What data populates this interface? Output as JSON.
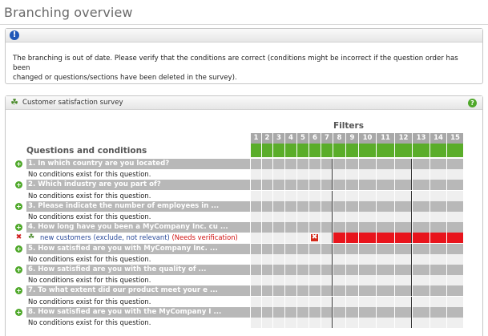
{
  "page": {
    "title": "Branching overview"
  },
  "info": {
    "icon": "exclamation-icon",
    "message_line1": "The branching is out of date. Please verify that the conditions are correct (conditions might be incorrect if the question order has been",
    "message_line2": "changed or questions/sections have been deleted in the survey)."
  },
  "survey": {
    "title": "Customer satisfaction survey",
    "help_icon": "?",
    "filters_label": "Filters",
    "questions_label": "Questions and conditions",
    "filter_numbers": [
      "1",
      "2",
      "3",
      "4",
      "5",
      "6",
      "7",
      "8",
      "9",
      "10",
      "11",
      "12",
      "13",
      "14",
      "15"
    ],
    "rows": [
      {
        "kind": "question",
        "text": "1. In which country are you located?"
      },
      {
        "kind": "condition",
        "text": "No conditions exist for this question."
      },
      {
        "kind": "question",
        "text": "2. Which industry are you part of?"
      },
      {
        "kind": "condition",
        "text": "No conditions exist for this question."
      },
      {
        "kind": "question",
        "text": "3. Please indicate the number of employees in ..."
      },
      {
        "kind": "condition",
        "text": "No conditions exist for this question."
      },
      {
        "kind": "question",
        "text": "4. How long have you been a MyCompany Inc. cu ..."
      },
      {
        "kind": "issue",
        "link": "new customers",
        "detail": " (exclude, not relevant) ",
        "warning": "(Needs verification)"
      },
      {
        "kind": "question",
        "text": "5. How satisfied are you with MyCompany Inc. ..."
      },
      {
        "kind": "condition",
        "text": "No conditions exist for this question."
      },
      {
        "kind": "question",
        "text": "6. How satisfied are you with the quality of ..."
      },
      {
        "kind": "condition",
        "text": "No conditions exist for this question."
      },
      {
        "kind": "question",
        "text": "7. To what extent did our product meet your e ..."
      },
      {
        "kind": "condition",
        "text": "No conditions exist for this question."
      },
      {
        "kind": "question",
        "text": "8. How satisfied are you with the MyCompany I ..."
      },
      {
        "kind": "condition",
        "text": "No conditions exist for this question."
      }
    ]
  },
  "colors": {
    "accent_green": "#5aad2a",
    "warning_red": "#e8141c",
    "bar_grey": "#b8b8b8"
  }
}
